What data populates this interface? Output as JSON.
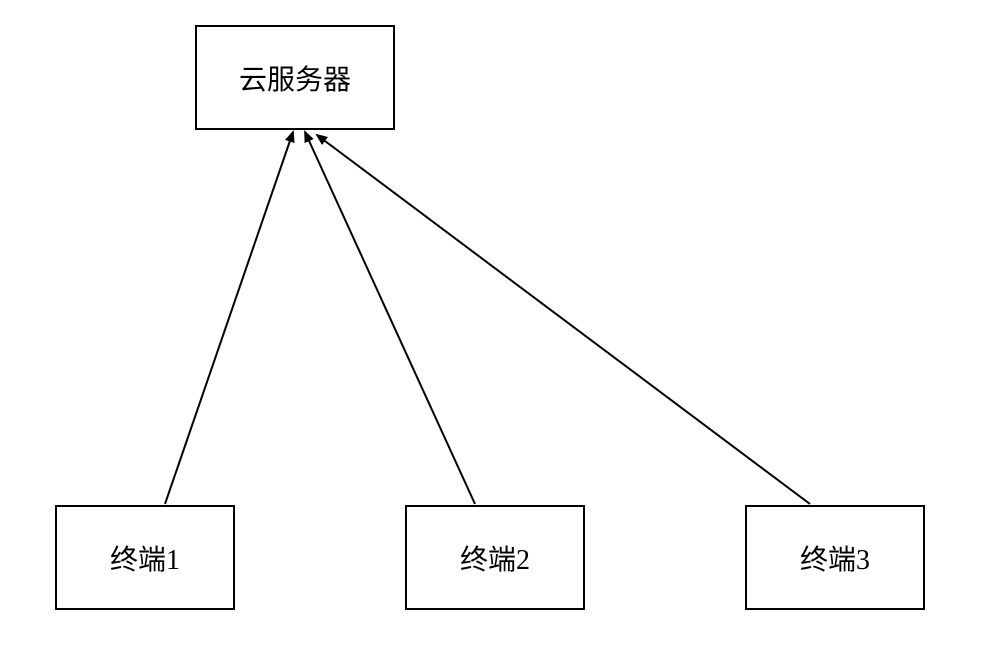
{
  "diagram": {
    "server": {
      "label": "云服务器"
    },
    "terminals": [
      {
        "label": "终端1"
      },
      {
        "label": "终端2"
      },
      {
        "label": "终端3"
      }
    ]
  }
}
